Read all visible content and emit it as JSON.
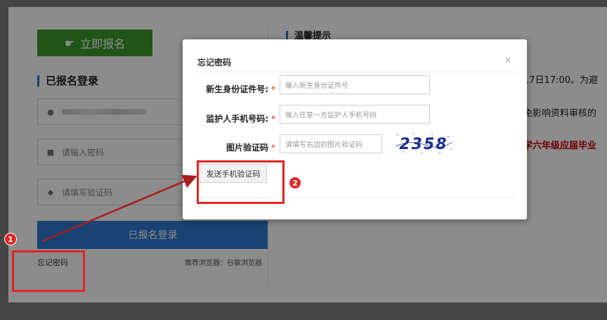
{
  "background_page": {
    "register_button": "立即报名",
    "login_title": "已报名登录",
    "tips_title": "温馨提示",
    "password_placeholder": "请输入密码",
    "code_placeholder": "请填写验证码",
    "login_button": "已报名登录",
    "forgot_link": "忘记密码",
    "browser_note": "推荐浏览器：谷歌浏览器",
    "tips": [
      "17日17:00。为避",
      "免影响资料审核的",
      "学六年级应届毕业"
    ]
  },
  "modal": {
    "title": "忘记密码",
    "close": "x",
    "fields": [
      {
        "label": "新生身份证件号:",
        "required": "*",
        "placeholder": "输入新生身份证件号"
      },
      {
        "label": "监护人手机号码:",
        "required": "*",
        "placeholder": "输入任意一方监护人手机号码"
      },
      {
        "label": "图片验证码",
        "required": "*",
        "placeholder": "请填写右边的图片验证码"
      }
    ],
    "captcha_text": "2358",
    "send_button": "发送手机验证码"
  },
  "annotations": {
    "badge_1": "1",
    "badge_2": "2",
    "color": "#e02525"
  },
  "colors": {
    "register_green": "#3c9a2a",
    "login_blue": "#2f7bd0",
    "accent_blue": "#2a73c9"
  }
}
